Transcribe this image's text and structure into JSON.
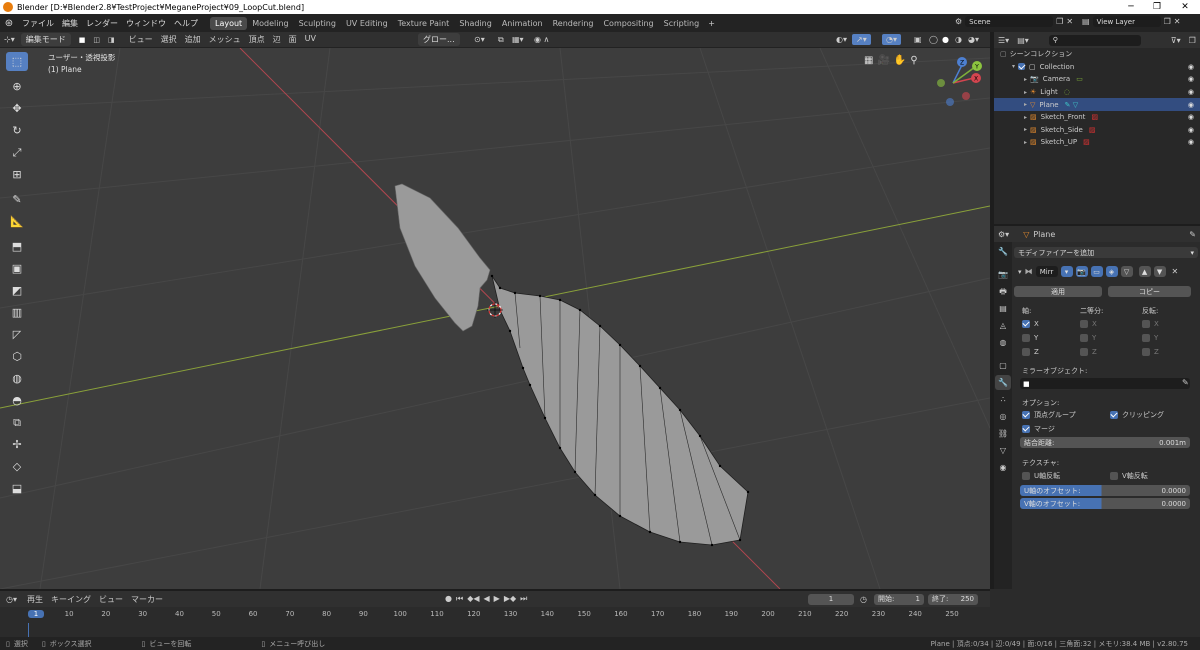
{
  "window": {
    "title": "Blender [D:¥Blender2.8¥TestProject¥MeganeProject¥09_LoopCut.blend]"
  },
  "topbar": {
    "menus": [
      "ファイル",
      "編集",
      "レンダー",
      "ウィンドウ",
      "ヘルプ"
    ],
    "workspaces": [
      "Layout",
      "Modeling",
      "Sculpting",
      "UV Editing",
      "Texture Paint",
      "Shading",
      "Animation",
      "Rendering",
      "Compositing",
      "Scripting"
    ],
    "active_workspace": "Layout",
    "add_tab": "+",
    "scene": "Scene",
    "view_layer": "View Layer"
  },
  "header3d": {
    "mode": "編集モード",
    "menus": [
      "ビュー",
      "選択",
      "追加",
      "メッシュ",
      "頂点",
      "辺",
      "面",
      "UV"
    ],
    "orientation": "グロー..."
  },
  "viewport": {
    "view_name": "ユーザー・透視投影",
    "object_name": "(1) Plane",
    "gizmo": {
      "x_label": "X",
      "y_label": "Y",
      "z_label": "Z"
    }
  },
  "tools": [
    "select-box",
    "cursor",
    "move",
    "rotate",
    "scale",
    "transform",
    "annotate",
    "measure",
    "extrude",
    "inset",
    "bevel",
    "loop-cut",
    "knife",
    "poly-build",
    "spin",
    "smooth",
    "edge-slide",
    "shrink",
    "shear",
    "rip"
  ],
  "outliner": {
    "root": "シーンコレクション",
    "items": [
      {
        "name": "Collection",
        "level": 1,
        "type": "collection",
        "selected": false
      },
      {
        "name": "Camera",
        "level": 2,
        "type": "camera",
        "selected": false
      },
      {
        "name": "Light",
        "level": 2,
        "type": "light",
        "selected": false
      },
      {
        "name": "Plane",
        "level": 2,
        "type": "mesh",
        "selected": true
      },
      {
        "name": "Sketch_Front",
        "level": 2,
        "type": "image",
        "selected": false
      },
      {
        "name": "Sketch_Side",
        "level": 2,
        "type": "image",
        "selected": false
      },
      {
        "name": "Sketch_UP",
        "level": 2,
        "type": "image",
        "selected": false
      }
    ]
  },
  "properties": {
    "object_name": "Plane",
    "add_modifier": "モディファイアーを追加",
    "modifier_name": "Mirr",
    "apply": "適用",
    "copy": "コピー",
    "axis_label": "軸:",
    "bisect_label": "二等分:",
    "flip_label": "反転:",
    "axis": [
      {
        "name": "X",
        "on": true
      },
      {
        "name": "Y",
        "on": false
      },
      {
        "name": "Z",
        "on": false
      }
    ],
    "bisect": [
      {
        "name": "X",
        "on": false
      },
      {
        "name": "Y",
        "on": false
      },
      {
        "name": "Z",
        "on": false
      }
    ],
    "flip": [
      {
        "name": "X",
        "on": false
      },
      {
        "name": "Y",
        "on": false
      },
      {
        "name": "Z",
        "on": false
      }
    ],
    "mirror_object_label": "ミラーオブジェクト:",
    "options_label": "オプション:",
    "vertex_group": "頂点グループ",
    "clipping": "クリッピング",
    "merge": "マージ",
    "merge_distance_label": "結合距離:",
    "merge_distance": "0.001m",
    "texture_label": "テクスチャ:",
    "u_flip": "U軸反転",
    "v_flip": "V軸反転",
    "u_offset_label": "U軸のオフセット:",
    "u_offset": "0.0000",
    "v_offset_label": "V軸のオフセット:",
    "v_offset": "0.0000"
  },
  "timeline": {
    "menus": [
      "再生",
      "キーイング",
      "ビュー",
      "マーカー"
    ],
    "current_frame": "1",
    "start_label": "開始:",
    "start": "1",
    "end_label": "終了:",
    "end": "250",
    "ticks": [
      "1",
      "10",
      "20",
      "30",
      "40",
      "50",
      "60",
      "70",
      "80",
      "90",
      "100",
      "110",
      "120",
      "130",
      "140",
      "150",
      "160",
      "170",
      "180",
      "190",
      "200",
      "210",
      "220",
      "230",
      "240",
      "250"
    ]
  },
  "statusbar": {
    "select": "選択",
    "box_select": "ボックス選択",
    "rotate_view": "ビューを回転",
    "call_menu": "メニュー呼び出し",
    "stats": "Plane | 頂点:0/34 | 辺:0/49 | 面:0/16 | 三角面:32 | メモリ:38.4 MB | v2.80.75"
  }
}
